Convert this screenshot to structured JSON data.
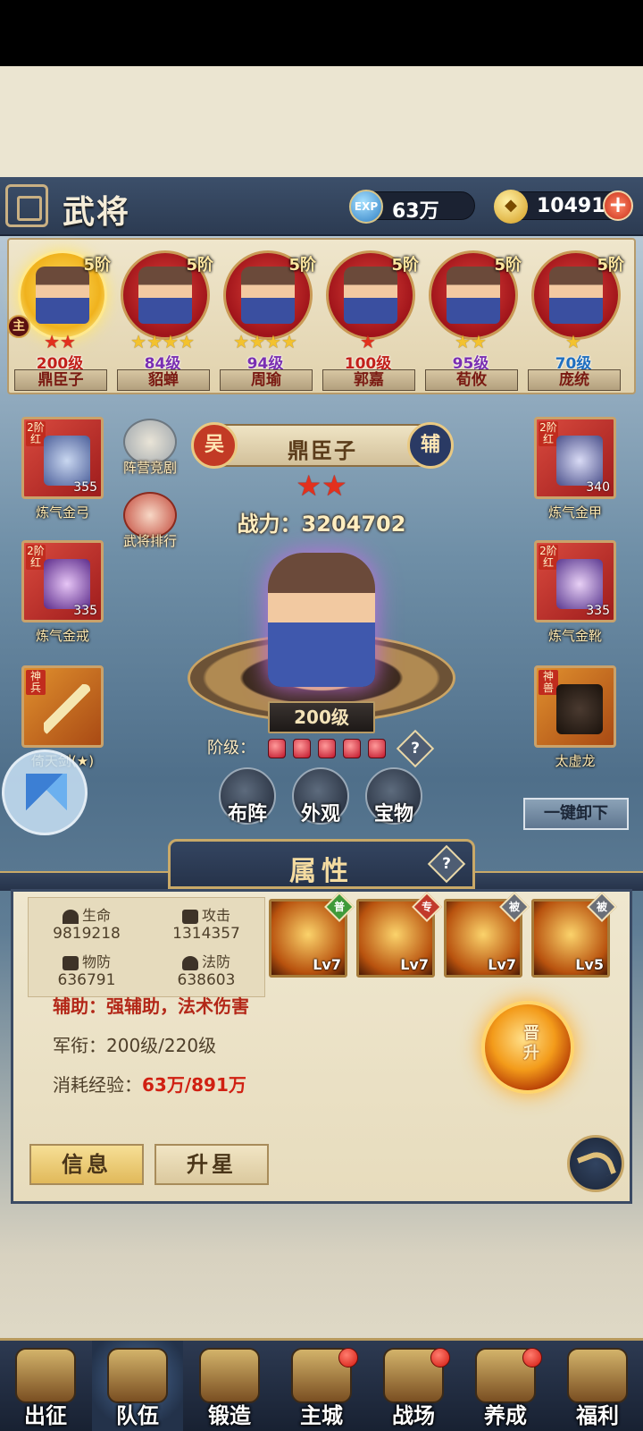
{
  "header": {
    "title": "武将",
    "exp_value": "63万",
    "exp_label": "EXP",
    "gold_value": "10491"
  },
  "heroes": [
    {
      "name": "鼎臣子",
      "rank": "5阶",
      "level": "200级",
      "stars": 2,
      "star_color": "red",
      "level_color": "#c2201a",
      "selected": true
    },
    {
      "name": "貂蝉",
      "rank": "5阶",
      "level": "84级",
      "stars": 4,
      "star_color": "gold",
      "level_color": "#7a2fb2",
      "selected": false
    },
    {
      "name": "周瑜",
      "rank": "5阶",
      "level": "94级",
      "stars": 4,
      "star_color": "gold",
      "level_color": "#7a2fb2",
      "selected": false
    },
    {
      "name": "郭嘉",
      "rank": "5阶",
      "level": "100级",
      "stars": 1,
      "star_color": "red",
      "level_color": "#c2201a",
      "selected": false
    },
    {
      "name": "荀攸",
      "rank": "5阶",
      "level": "95级",
      "stars": 2,
      "star_color": "gold",
      "level_color": "#7a2fb2",
      "selected": false
    },
    {
      "name": "庞统",
      "rank": "5阶",
      "level": "70级",
      "stars": 1,
      "star_color": "gold",
      "level_color": "#1f6fbf",
      "selected": false
    }
  ],
  "main_badge": "主",
  "equipment": {
    "left": [
      {
        "name": "炼气金弓",
        "tag": "2阶红",
        "count": "355"
      },
      {
        "name": "炼气金戒",
        "tag": "2阶红",
        "count": "335"
      },
      {
        "name": "倚天剑(★)",
        "tag": "神兵",
        "count": ""
      }
    ],
    "right": [
      {
        "name": "炼气金甲",
        "tag": "2阶红",
        "count": "340"
      },
      {
        "name": "炼气金靴",
        "tag": "2阶红",
        "count": "335"
      },
      {
        "name": "太虚龙",
        "tag": "神兽",
        "count": ""
      }
    ]
  },
  "side_buttons": {
    "camp_compete": "阵营竞剧",
    "ranking": "武将排行"
  },
  "selected_hero": {
    "faction": "吴",
    "name": "鼎臣子",
    "role": "辅",
    "stars": 2,
    "power_label": "战力：",
    "power_value": "3204702",
    "level": "200级",
    "stage_label": "阶级：",
    "stage_gems": 5
  },
  "actions": {
    "formation": "布阵",
    "appearance": "外观",
    "treasure": "宝物",
    "unequip_all": "一键卸下"
  },
  "attributes": {
    "tab_title": "属性",
    "stats": [
      {
        "key": "生命",
        "value": "9819218"
      },
      {
        "key": "攻击",
        "value": "1314357"
      },
      {
        "key": "物防",
        "value": "636791"
      },
      {
        "key": "法防",
        "value": "638603"
      }
    ],
    "skills": [
      {
        "badge": "普",
        "level": "Lv7",
        "badge_color": "#3f9a3a"
      },
      {
        "badge": "专",
        "level": "Lv7",
        "badge_color": "#c23a2b"
      },
      {
        "badge": "被",
        "level": "Lv7",
        "badge_color": "#6a6f78"
      },
      {
        "badge": "被",
        "level": "Lv5",
        "badge_color": "#6a6f78"
      }
    ],
    "role_desc": "辅助：强辅助，法术伤害",
    "rank_label": "军衔：",
    "rank_value": "200级/220级",
    "exp_label": "消耗经验：",
    "exp_value": "63万/891万",
    "promote": "晋升"
  },
  "panel_tabs": {
    "info": "信息",
    "star_up": "升星"
  },
  "bottom_nav": [
    {
      "label": "出征",
      "dot": false,
      "active": false
    },
    {
      "label": "队伍",
      "dot": false,
      "active": true
    },
    {
      "label": "锻造",
      "dot": false,
      "active": false
    },
    {
      "label": "主城",
      "dot": true,
      "active": false
    },
    {
      "label": "战场",
      "dot": true,
      "active": false
    },
    {
      "label": "养成",
      "dot": true,
      "active": false
    },
    {
      "label": "福利",
      "dot": false,
      "active": false
    }
  ]
}
